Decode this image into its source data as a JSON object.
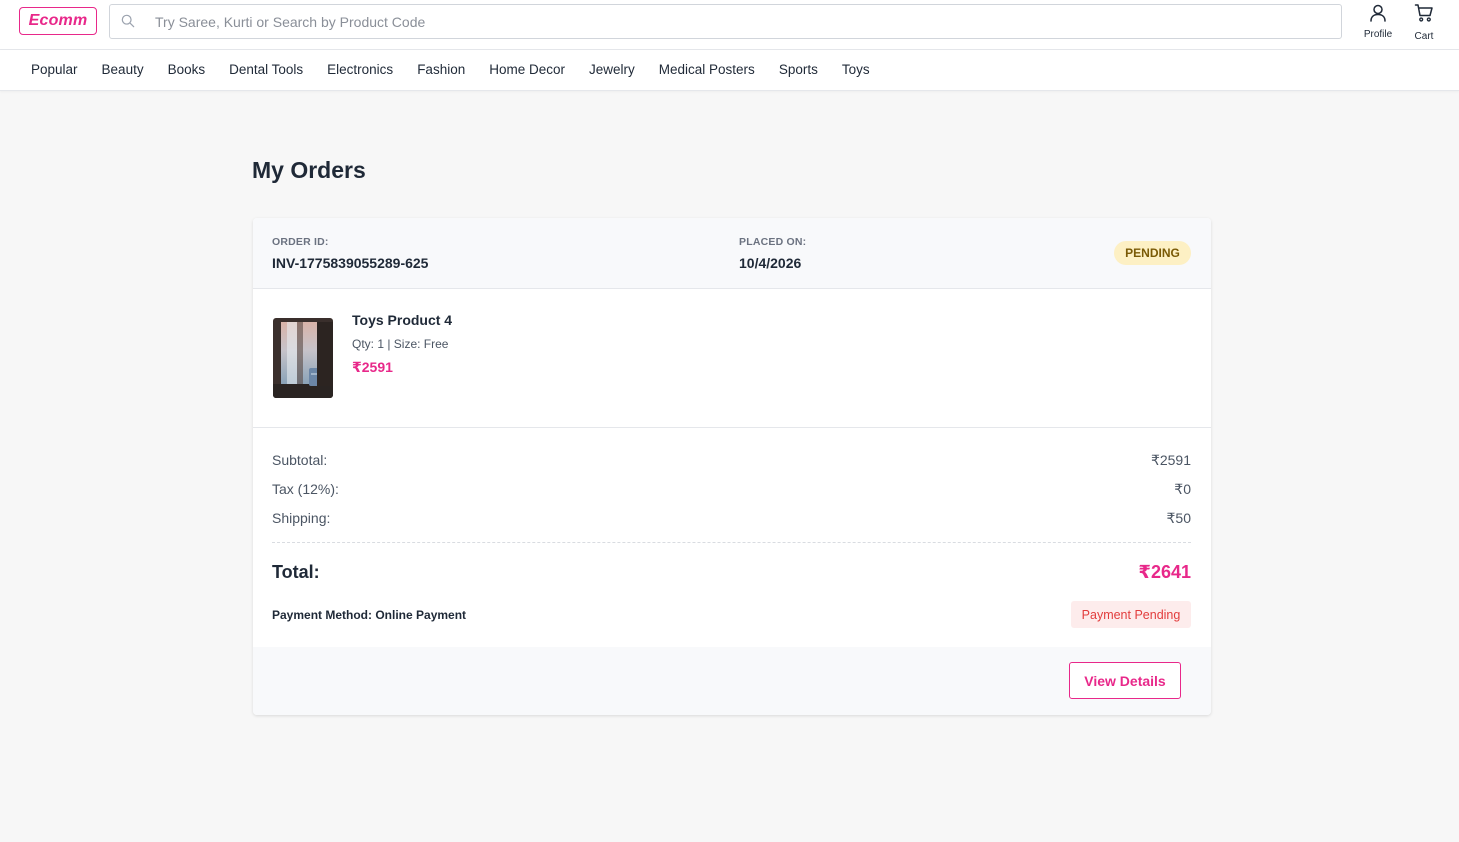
{
  "header": {
    "logo_text": "Ecomm",
    "search_placeholder": "Try Saree, Kurti or Search by Product Code",
    "profile_label": "Profile",
    "cart_label": "Cart"
  },
  "categories": [
    "Popular",
    "Beauty",
    "Books",
    "Dental Tools",
    "Electronics",
    "Fashion",
    "Home Decor",
    "Jewelry",
    "Medical Posters",
    "Sports",
    "Toys"
  ],
  "page": {
    "title": "My Orders"
  },
  "order": {
    "id_label": "ORDER ID:",
    "id_value": "INV-1775839055289-625",
    "placed_label": "PLACED ON:",
    "placed_value": "10/4/2026",
    "status": "PENDING",
    "item": {
      "name": "Toys Product 4",
      "meta": "Qty: 1 | Size: Free",
      "price": "₹2591"
    },
    "summary": {
      "subtotal_label": "Subtotal:",
      "subtotal_value": "₹2591",
      "tax_label": "Tax (12%):",
      "tax_value": "₹0",
      "shipping_label": "Shipping:",
      "shipping_value": "₹50",
      "total_label": "Total:",
      "total_value": "₹2641"
    },
    "payment_method": "Payment Method: Online Payment",
    "payment_status": "Payment Pending",
    "view_details_label": "View Details"
  },
  "colors": {
    "accent": "#e8288a",
    "status_pending_bg": "#fdf0c4",
    "payment_pending_text": "#e23d3d"
  }
}
